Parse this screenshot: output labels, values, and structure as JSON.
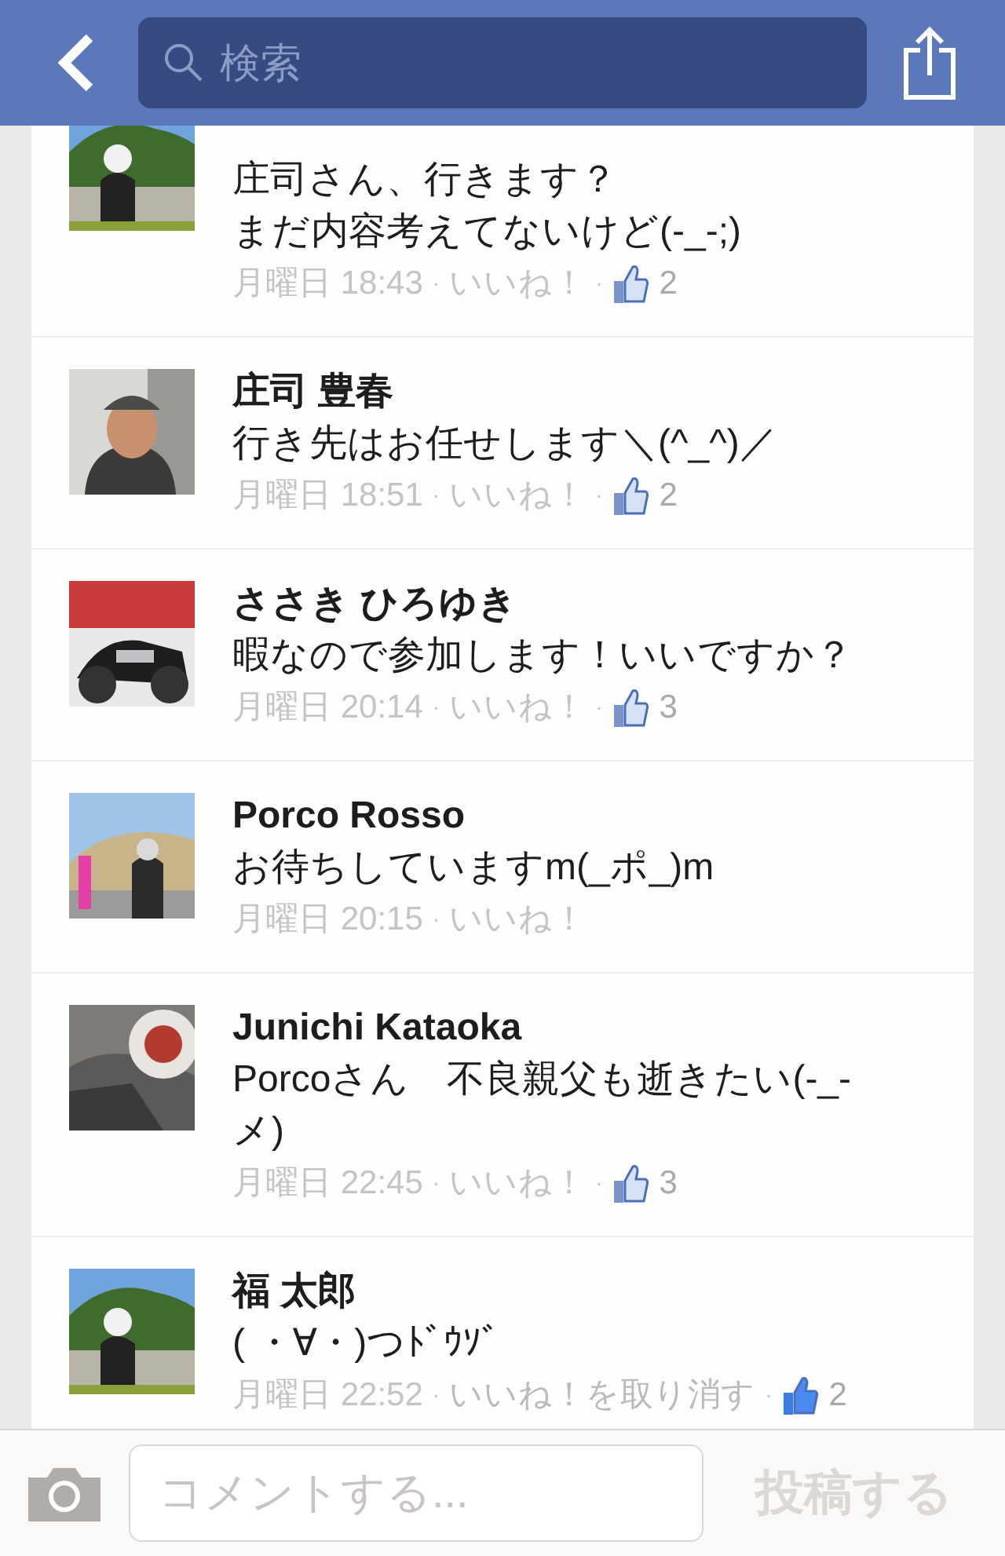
{
  "header": {
    "search": {
      "placeholder": "検索"
    }
  },
  "comments": [
    {
      "text": [
        "庄司さん、行きます？",
        "まだ内容考えてないけど(-_-;)"
      ],
      "time": "月曜日 18:43",
      "like_label": "いいね！",
      "likes": "2",
      "liked": false
    },
    {
      "name": "庄司 豊春",
      "text": "行き先はお任せします＼(^_^)／",
      "time": "月曜日 18:51",
      "like_label": "いいね！",
      "likes": "2",
      "liked": false
    },
    {
      "name": "ささき ひろゆき",
      "text": "暇なので参加します！いいですか？",
      "time": "月曜日 20:14",
      "like_label": "いいね！",
      "likes": "3",
      "liked": false
    },
    {
      "name": "Porco Rosso",
      "text": "お待ちしていますm(_ポ_)m",
      "time": "月曜日 20:15",
      "like_label": "いいね！",
      "liked": false
    },
    {
      "name": "Junichi Kataoka",
      "text": "Porcoさん　不良親父も逝きたい(-_-メ)",
      "time": "月曜日 22:45",
      "like_label": "いいね！",
      "likes": "3",
      "liked": false
    },
    {
      "name": "福 太郎",
      "text": "( ・∀・)つﾄﾞｳｿﾞ",
      "time": "月曜日 22:52",
      "like_label": "いいね！を取り消す",
      "likes": "2",
      "liked": true
    }
  ],
  "meta_separator": "·",
  "composer": {
    "placeholder": "コメントする...",
    "post_button": "投稿する"
  }
}
